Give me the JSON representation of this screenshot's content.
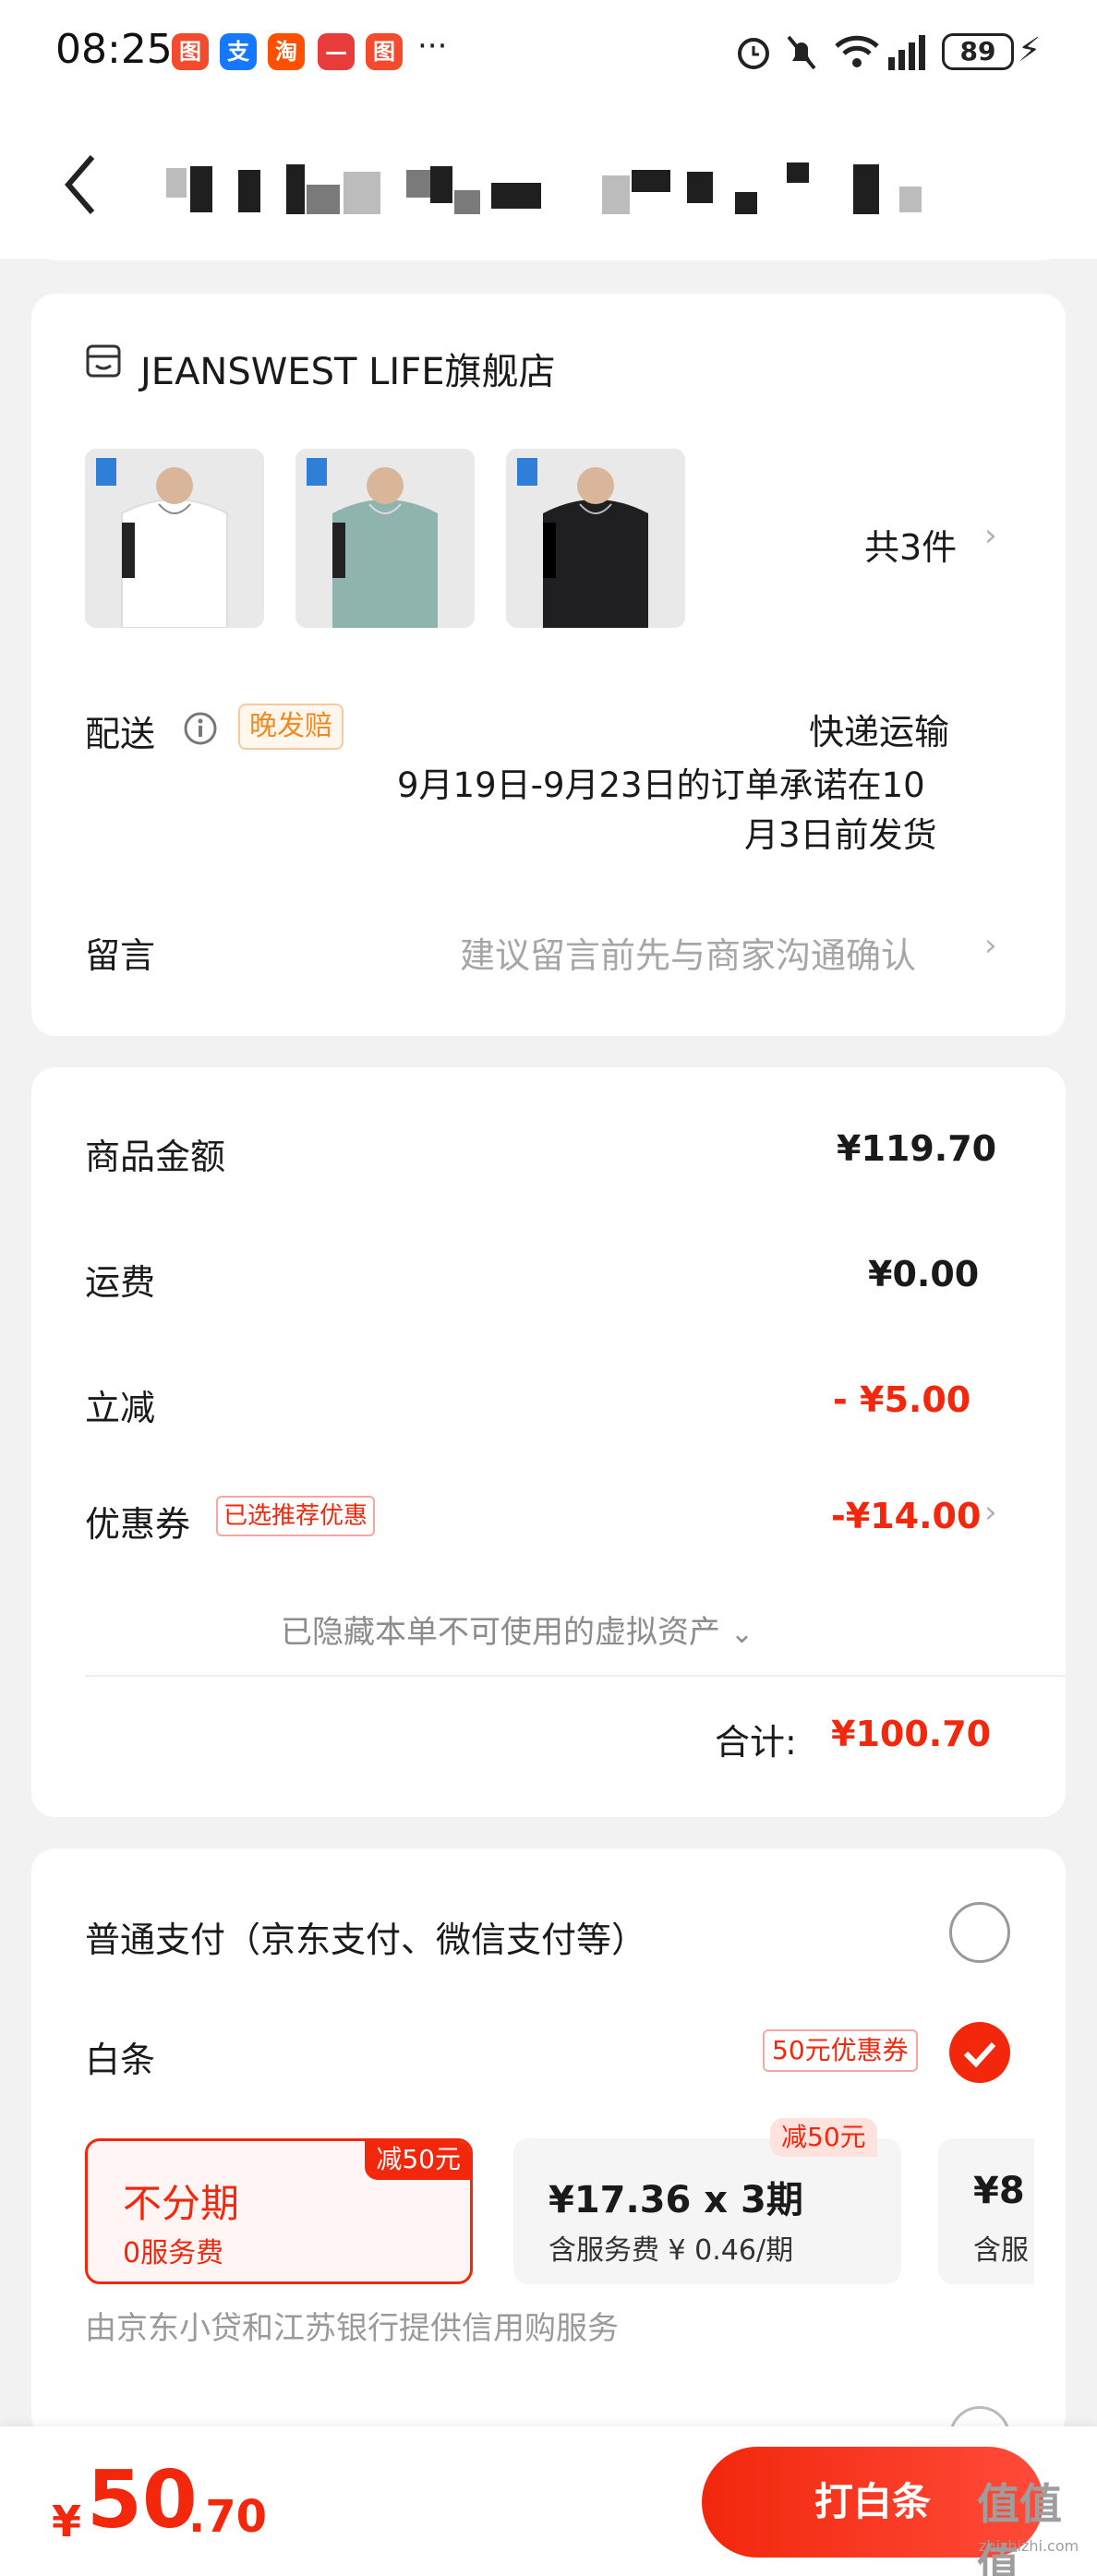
{
  "status_bar": {
    "time": "08:25",
    "battery": "89",
    "more": "···",
    "app_icons": [
      {
        "name": "red-app-icon",
        "color": "#f44a2e",
        "glyph": "图"
      },
      {
        "name": "alipay-icon",
        "color": "#1677ff",
        "glyph": "支"
      },
      {
        "name": "taobao-icon",
        "color": "#ff5000",
        "glyph": "淘"
      },
      {
        "name": "red-app-icon-2",
        "color": "#e83b3b",
        "glyph": "—"
      },
      {
        "name": "red-app-icon-3",
        "color": "#f44a2e",
        "glyph": "图"
      }
    ]
  },
  "store": {
    "name": "JEANSWEST LIFE旗舰店",
    "item_count": "共3件",
    "products": [
      {
        "color": "#ffffff",
        "name": "white-sweatshirt"
      },
      {
        "color": "#8fb3ad",
        "name": "teal-sweatshirt"
      },
      {
        "color": "#1f1f22",
        "name": "black-sweatshirt"
      }
    ]
  },
  "delivery": {
    "label": "配送",
    "tag": "晚发赔",
    "method": "快递运输",
    "promise_line1": "9月19日-9月23日的订单承诺在10",
    "promise_line2": "月3日前发货"
  },
  "message": {
    "label": "留言",
    "placeholder": "建议留言前先与商家沟通确认"
  },
  "pricing": {
    "goods_label": "商品金额",
    "goods_value": "¥119.70",
    "shipping_label": "运费",
    "shipping_value": "¥0.00",
    "discount_label": "立减",
    "discount_value": "- ¥5.00",
    "coupon_label": "优惠券",
    "coupon_tag": "已选推荐优惠",
    "coupon_value": "-¥14.00",
    "hidden_assets": "已隐藏本单不可使用的虚拟资产",
    "total_label": "合计:",
    "total_value": "¥100.70"
  },
  "payment": {
    "normal_label": "普通支付（京东支付、微信支付等）",
    "baitiao_label": "白条",
    "baitiao_coupon": "50元优惠券",
    "plans": [
      {
        "title": "不分期",
        "sub": "0服务费",
        "badge": "减50元"
      },
      {
        "title": "¥17.36 x 3期",
        "sub": "含服务费 ¥ 0.46/期",
        "badge": "减50元"
      },
      {
        "title": "¥8",
        "sub": "含服"
      }
    ],
    "provider_note": "由京东小贷和江苏银行提供信用购服务"
  },
  "bottom": {
    "currency": "¥",
    "amount_int": "50",
    "amount_dec": ".70",
    "pay_button": "打白条"
  },
  "watermark": {
    "main": "值值值",
    "sub": "zhizhizhi.com"
  },
  "colors": {
    "accent": "#f2270c",
    "orange": "#f08a24",
    "background": "#f2f2f2"
  }
}
